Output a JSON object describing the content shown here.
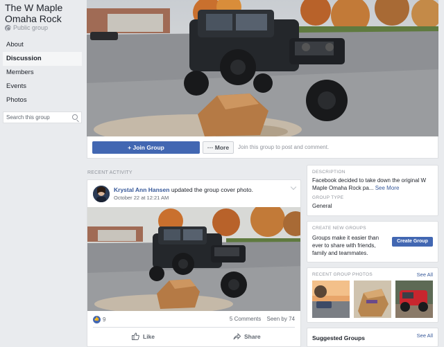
{
  "group": {
    "name": "The W Maple Omaha Rock",
    "privacy": "Public group"
  },
  "nav": {
    "items": [
      {
        "label": "About"
      },
      {
        "label": "Discussion"
      },
      {
        "label": "Members"
      },
      {
        "label": "Events"
      },
      {
        "label": "Photos"
      }
    ],
    "active": "Discussion"
  },
  "search": {
    "placeholder": "Search this group"
  },
  "cover_actions": {
    "join_label": "+ Join Group",
    "more_label": "··· More",
    "hint": "Join this group to post and comment."
  },
  "recent_activity": {
    "label": "RECENT ACTIVITY"
  },
  "post": {
    "author": "Krystal Ann Hansen",
    "action": " updated the group cover photo.",
    "time": "October 22 at 12:21 AM",
    "reaction_count": "9",
    "comments": "5 Comments",
    "seen": "Seen by 74",
    "like_label": "Like",
    "share_label": "Share"
  },
  "description": {
    "label": "DESCRIPTION",
    "text": "Facebook decided to take down the original W Maple Omaha Rock pa...",
    "see_more": "See More",
    "type_label": "GROUP TYPE",
    "type_value": "General"
  },
  "create_groups": {
    "label": "CREATE NEW GROUPS",
    "text": "Groups make it easier than ever to share with friends, family and teammates.",
    "button": "Create Group"
  },
  "recent_photos": {
    "label": "RECENT GROUP PHOTOS",
    "see_all": "See All"
  },
  "suggested": {
    "title": "Suggested Groups",
    "see_all": "See All"
  },
  "colors": {
    "facebook_blue": "#4267b2",
    "link_blue": "#365899",
    "background": "#e9ebee"
  }
}
